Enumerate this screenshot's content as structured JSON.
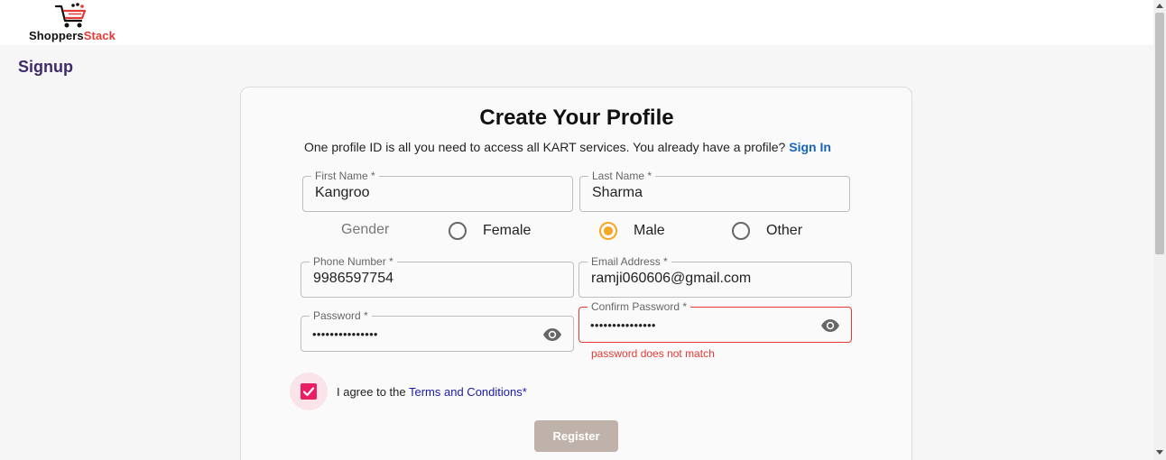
{
  "brand": {
    "name_part1": "Shoppers",
    "name_part2": "Stack",
    "accent_color": "#e53935"
  },
  "page": {
    "title": "Signup"
  },
  "form": {
    "heading": "Create Your Profile",
    "subtext": "One profile ID is all you need to access all KART services. You already have a profile?",
    "signin_link": "Sign In",
    "first_name": {
      "label": "First Name",
      "required": " *",
      "value": "Kangroo"
    },
    "last_name": {
      "label": "Last Name",
      "required": " *",
      "value": "Sharma"
    },
    "gender": {
      "label": "Gender",
      "options": [
        "Female",
        "Male",
        "Other"
      ],
      "selected": "Male"
    },
    "phone": {
      "label": "Phone Number",
      "required": " *",
      "value": "9986597754"
    },
    "email": {
      "label": "Email Address",
      "required": " *",
      "value": "ramji060606@gmail.com"
    },
    "password": {
      "label": "Password",
      "required": " *",
      "value": "•••••••••••••••"
    },
    "confirm_password": {
      "label": "Confirm Password",
      "required": " *",
      "value": "•••••••••••••••",
      "error": "password does not match"
    },
    "terms": {
      "prefix": "I agree to the ",
      "link": "Terms and Conditions",
      "suffix": "*",
      "checked": true
    },
    "register_label": "Register"
  },
  "colors": {
    "radio_selected": "#f5a623",
    "checkbox": "#e91e63",
    "error": "#e53935",
    "link": "#1565c0"
  }
}
